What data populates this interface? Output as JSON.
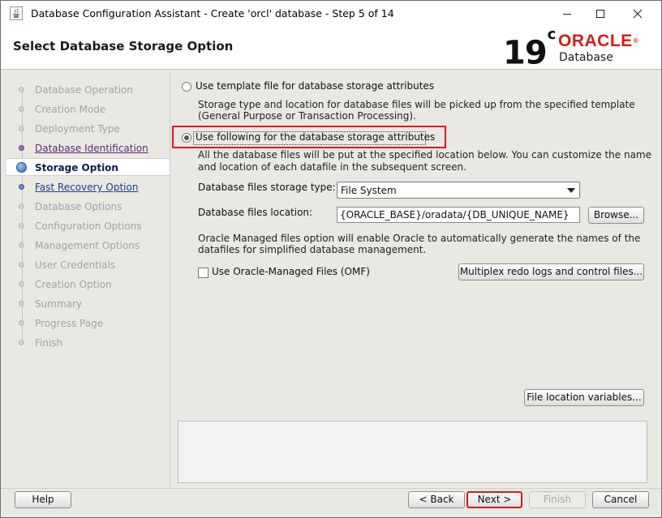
{
  "window": {
    "title": "Database Configuration Assistant - Create 'orcl' database - Step 5 of 14",
    "icon": "java-cup-icon"
  },
  "header": {
    "page_title": "Select Database Storage Option",
    "logo": {
      "version": "19",
      "version_suffix": "c",
      "brand": "ORACLE",
      "product": "Database",
      "brand_color": "#d61b15"
    }
  },
  "sidebar": {
    "steps": [
      {
        "label": "Database Operation",
        "state": "disabled"
      },
      {
        "label": "Creation Mode",
        "state": "disabled"
      },
      {
        "label": "Deployment Type",
        "state": "disabled"
      },
      {
        "label": "Database Identification",
        "state": "visited"
      },
      {
        "label": "Storage Option",
        "state": "current"
      },
      {
        "label": "Fast Recovery Option",
        "state": "next"
      },
      {
        "label": "Database Options",
        "state": "disabled"
      },
      {
        "label": "Configuration Options",
        "state": "disabled"
      },
      {
        "label": "Management Options",
        "state": "disabled"
      },
      {
        "label": "User Credentials",
        "state": "disabled"
      },
      {
        "label": "Creation Option",
        "state": "disabled"
      },
      {
        "label": "Summary",
        "state": "disabled"
      },
      {
        "label": "Progress Page",
        "state": "disabled"
      },
      {
        "label": "Finish",
        "state": "disabled"
      }
    ]
  },
  "main": {
    "option_template": {
      "label": "Use template file for database storage attributes",
      "selected": false,
      "desc_line1": "Storage type and location for database files will be picked up from the specified template",
      "desc_line2": "(General Purpose or Transaction Processing)."
    },
    "option_following": {
      "label": "Use following for the database storage attributes",
      "selected": true,
      "desc_line1": "All the database files will be put at the specified location below. You can customize the name",
      "desc_line2": "and location of each datafile in the subsequent screen."
    },
    "storage_type": {
      "label": "Database files storage type:",
      "value": "File System"
    },
    "files_location": {
      "label": "Database files location:",
      "value": "{ORACLE_BASE}/oradata/{DB_UNIQUE_NAME}",
      "browse": "Browse..."
    },
    "omf": {
      "desc_line1": "Oracle Managed files option will enable Oracle to automatically generate the names of the",
      "desc_line2": "datafiles for simplified database management.",
      "checkbox_label": "Use Oracle-Managed Files (OMF)",
      "checked": false
    },
    "multiplex_button": "Multiplex redo logs and control files...",
    "file_location_vars_button": "File location variables..."
  },
  "footer": {
    "help": "Help",
    "back": "< Back",
    "next": "Next >",
    "finish": "Finish",
    "cancel": "Cancel"
  }
}
